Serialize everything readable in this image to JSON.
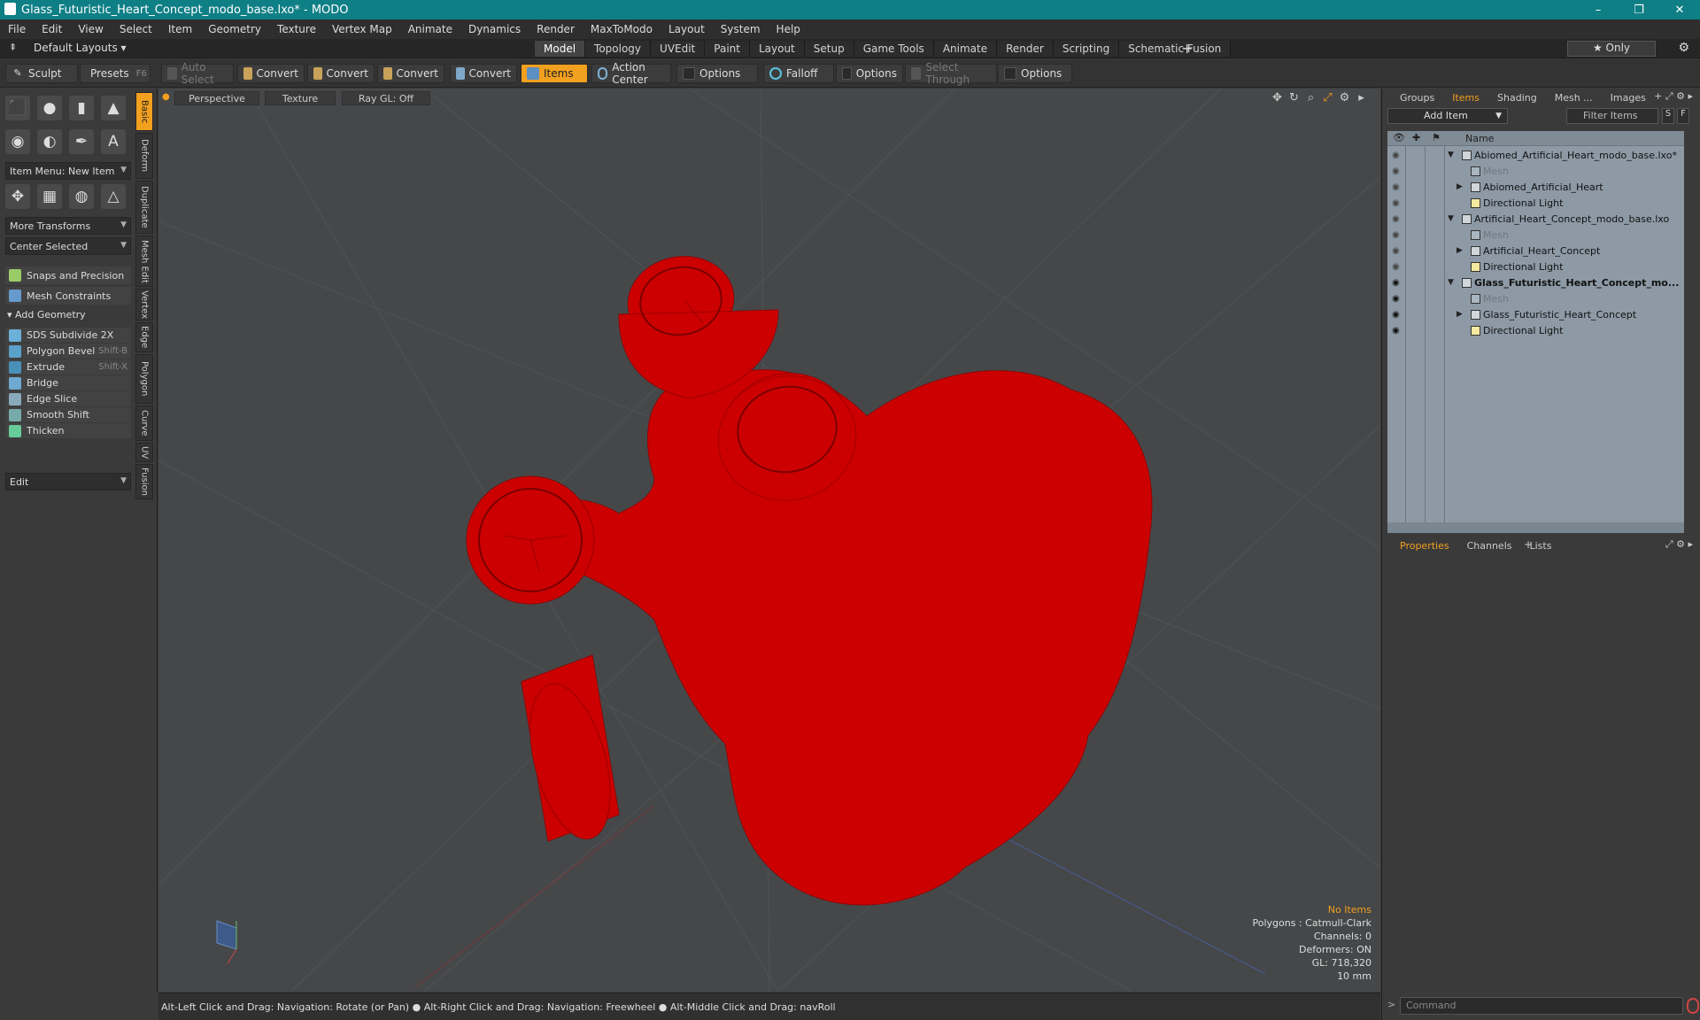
{
  "window": {
    "title": "Glass_Futuristic_Heart_Concept_modo_base.lxo* - MODO",
    "controls": [
      "–",
      "❐",
      "✕"
    ]
  },
  "menu": [
    "File",
    "Edit",
    "View",
    "Select",
    "Item",
    "Geometry",
    "Texture",
    "Vertex Map",
    "Animate",
    "Dynamics",
    "Render",
    "MaxToModo",
    "Layout",
    "System",
    "Help"
  ],
  "layouts": {
    "label": "Default Layouts",
    "tabs": [
      "Model",
      "Topology",
      "UVEdit",
      "Paint",
      "Layout",
      "Setup",
      "Game Tools",
      "Animate",
      "Render",
      "Scripting",
      "Schematic Fusion"
    ],
    "active": "Model",
    "add": "+",
    "only": "★  Only"
  },
  "toolbar": {
    "sculpt": "Sculpt",
    "presets": "Presets",
    "presets_key": "F6",
    "auto_select": "Auto Select",
    "convert1": "Convert",
    "convert2": "Convert",
    "convert3": "Convert",
    "convert4": "Convert",
    "items": "Items",
    "action_center": "Action Center",
    "options1": "Options",
    "falloff": "Falloff",
    "options2": "Options",
    "select_through": "Select Through",
    "options3": "Options"
  },
  "left": {
    "item_menu": "Item Menu: New Item",
    "more_transforms": "More Transforms",
    "center_selected": "Center Selected",
    "snaps": "Snaps and Precision",
    "mesh_constraints": "Mesh Constraints",
    "add_geometry": "Add Geometry",
    "tools": [
      {
        "label": "SDS Subdivide 2X",
        "shortcut": ""
      },
      {
        "label": "Polygon Bevel",
        "shortcut": "Shift-B"
      },
      {
        "label": "Extrude",
        "shortcut": "Shift-X"
      },
      {
        "label": "Bridge",
        "shortcut": ""
      },
      {
        "label": "Edge Slice",
        "shortcut": ""
      },
      {
        "label": "Smooth Shift",
        "shortcut": ""
      },
      {
        "label": "Thicken",
        "shortcut": ""
      }
    ],
    "edit": "Edit",
    "vtabs": [
      "Basic",
      "Deform",
      "Duplicate",
      "Mesh Edit",
      "Vertex",
      "Edge",
      "Polygon",
      "Curve",
      "UV",
      "Fusion"
    ]
  },
  "viewport": {
    "perspective": "Perspective",
    "texture": "Texture",
    "raygl": "Ray GL: Off",
    "stats": {
      "selection": "No Items",
      "polygons": "Polygons : Catmull-Clark",
      "channels": "Channels: 0",
      "deformers": "Deformers: ON",
      "gl": "GL: 718,320",
      "scale": "10 mm"
    },
    "mesh_color": "#cc0000"
  },
  "status": "Alt-Left Click and Drag: Navigation: Rotate (or Pan) ● Alt-Right Click and Drag: Navigation: Freewheel ● Alt-Middle Click and Drag: navRoll",
  "right": {
    "top_tabs": [
      "Groups",
      "Items",
      "Shading",
      "Mesh ...",
      "Images"
    ],
    "top_active": "Items",
    "add_item": "Add Item",
    "filter": "Filter Items",
    "name_col": "Name",
    "tree": [
      {
        "label": "Abiomed_Artificial_Heart_modo_base.lxo*",
        "indent": 0,
        "type": "scene",
        "tri": "▼",
        "eye": false,
        "bold": false,
        "dim": false
      },
      {
        "label": "Mesh",
        "indent": 1,
        "type": "mesh",
        "tri": "",
        "eye": false,
        "bold": false,
        "dim": true
      },
      {
        "label": "Abiomed_Artificial_Heart",
        "indent": 1,
        "type": "group",
        "tri": "▶",
        "eye": false,
        "bold": false,
        "dim": false
      },
      {
        "label": "Directional Light",
        "indent": 1,
        "type": "light",
        "tri": "",
        "eye": false,
        "bold": false,
        "dim": false
      },
      {
        "label": "Artificial_Heart_Concept_modo_base.lxo",
        "indent": 0,
        "type": "scene",
        "tri": "▼",
        "eye": false,
        "bold": false,
        "dim": false
      },
      {
        "label": "Mesh",
        "indent": 1,
        "type": "mesh",
        "tri": "",
        "eye": false,
        "bold": false,
        "dim": true
      },
      {
        "label": "Artificial_Heart_Concept",
        "indent": 1,
        "type": "group",
        "tri": "▶",
        "eye": false,
        "bold": false,
        "dim": false
      },
      {
        "label": "Directional Light",
        "indent": 1,
        "type": "light",
        "tri": "",
        "eye": false,
        "bold": false,
        "dim": false
      },
      {
        "label": "Glass_Futuristic_Heart_Concept_mo...",
        "indent": 0,
        "type": "scene",
        "tri": "▼",
        "eye": true,
        "bold": true,
        "dim": false
      },
      {
        "label": "Mesh",
        "indent": 1,
        "type": "mesh",
        "tri": "",
        "eye": true,
        "bold": false,
        "dim": true
      },
      {
        "label": "Glass_Futuristic_Heart_Concept",
        "indent": 1,
        "type": "group",
        "tri": "▶",
        "eye": true,
        "bold": false,
        "dim": false
      },
      {
        "label": "Directional Light",
        "indent": 1,
        "type": "light",
        "tri": "",
        "eye": true,
        "bold": false,
        "dim": false
      }
    ],
    "bottom_tabs": [
      "Properties",
      "Channels",
      "Lists"
    ],
    "bottom_active": "Properties",
    "command": "Command"
  }
}
